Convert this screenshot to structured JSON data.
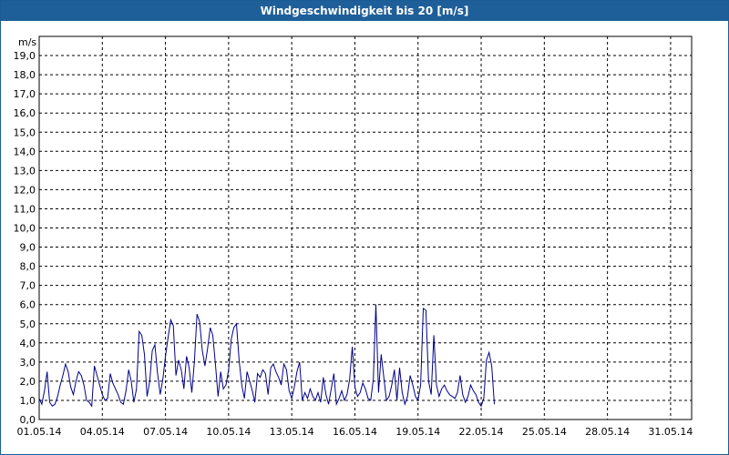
{
  "window": {
    "title": "Windgeschwindigkeit bis 20 [m/s]"
  },
  "chart_data": {
    "type": "line",
    "title": "Windgeschwindigkeit bis 20 [m/s]",
    "ylabel": "m/s",
    "xlabel": "",
    "ylim": [
      0,
      20
    ],
    "xlim": [
      "01.05.14 00:00",
      "01.06.14 00:00"
    ],
    "grid": true,
    "y_ticks": [
      "0,0",
      "1,0",
      "2,0",
      "3,0",
      "4,0",
      "5,0",
      "6,0",
      "7,0",
      "8,0",
      "9,0",
      "10,0",
      "11,0",
      "12,0",
      "13,0",
      "14,0",
      "15,0",
      "16,0",
      "17,0",
      "18,0",
      "19,0"
    ],
    "x_ticks": [
      "01.05.14",
      "04.05.14",
      "07.05.14",
      "10.05.14",
      "13.05.14",
      "16.05.14",
      "19.05.14",
      "22.05.14",
      "25.05.14",
      "28.05.14",
      "31.05.14"
    ],
    "line_color": "#00008b",
    "series": [
      {
        "x_start": "01.05.14 00:00",
        "x_step_hours": 3,
        "values": [
          1.1,
          0.8,
          1.5,
          2.5,
          0.9,
          0.7,
          0.8,
          1.2,
          1.8,
          2.3,
          2.9,
          2.5,
          1.7,
          1.3,
          2.0,
          2.5,
          2.3,
          1.8,
          1.0,
          0.9,
          0.7,
          2.8,
          2.3,
          1.8,
          1.3,
          1.0,
          1.1,
          2.4,
          1.9,
          1.6,
          1.3,
          0.9,
          0.8,
          1.5,
          2.6,
          2.0,
          0.9,
          1.6,
          4.6,
          4.4,
          3.4,
          1.2,
          2.0,
          3.6,
          3.9,
          2.4,
          1.3,
          2.1,
          3.3,
          4.3,
          5.2,
          4.9,
          2.3,
          3.1,
          2.6,
          1.6,
          3.3,
          2.7,
          1.4,
          3.0,
          5.5,
          5.1,
          3.6,
          2.8,
          3.7,
          4.8,
          4.4,
          2.9,
          1.2,
          2.5,
          1.6,
          1.8,
          2.6,
          4.2,
          4.8,
          5.0,
          3.1,
          1.8,
          1.1,
          2.5,
          2.0,
          1.5,
          0.9,
          2.4,
          2.2,
          2.6,
          2.4,
          1.3,
          2.7,
          2.9,
          2.5,
          2.2,
          1.8,
          2.9,
          2.6,
          1.5,
          1.1,
          1.7,
          2.5,
          3.0,
          1.0,
          1.4,
          1.1,
          1.6,
          1.2,
          1.0,
          1.4,
          0.9,
          2.2,
          1.3,
          0.8,
          1.6,
          2.4,
          0.8,
          1.1,
          1.5,
          1.0,
          1.3,
          2.1,
          3.8,
          1.7,
          1.2,
          1.4,
          1.9,
          1.6,
          1.1,
          1.0,
          2.1,
          6.0,
          1.4,
          3.4,
          2.2,
          1.0,
          1.2,
          1.8,
          2.6,
          1.0,
          2.7,
          1.4,
          0.8,
          1.2,
          2.3,
          1.8,
          1.2,
          1.0,
          1.8,
          5.8,
          5.7,
          2.0,
          1.3,
          4.4,
          1.8,
          1.2,
          1.6,
          1.8,
          1.5,
          1.3,
          1.2,
          1.1,
          1.4,
          2.3,
          1.3,
          0.9,
          1.2,
          1.8,
          1.5,
          1.3,
          0.9,
          0.7,
          1.1,
          3.1,
          3.5,
          2.8,
          0.8
        ]
      }
    ]
  }
}
